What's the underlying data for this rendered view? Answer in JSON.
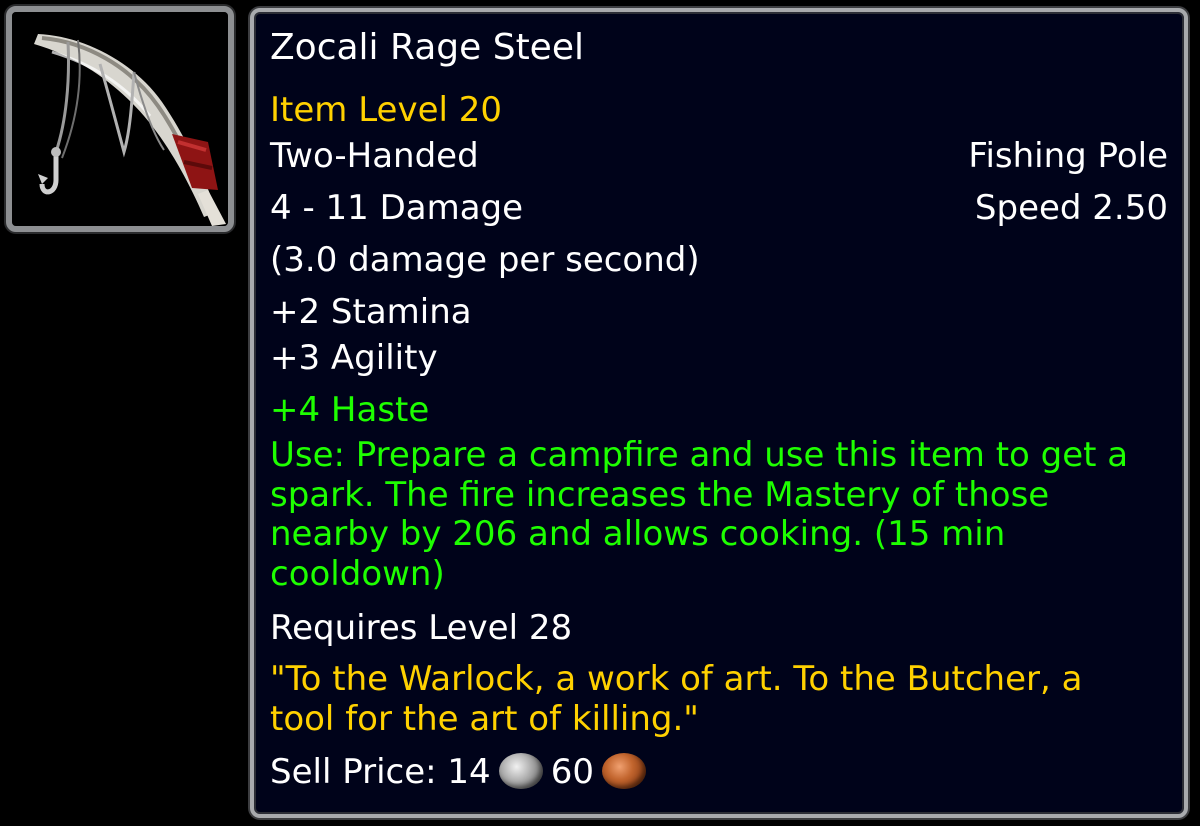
{
  "item": {
    "icon": "fishing-pole-icon",
    "name": "Zocali Rage Steel",
    "item_level": "Item Level 20",
    "slot": "Two-Handed",
    "type": "Fishing Pole",
    "damage": "4 - 11 Damage",
    "speed": "Speed 2.50",
    "dps": "(3.0 damage per second)",
    "stats": [
      "+2 Stamina",
      "+3 Agility"
    ],
    "bonus_stat": "+4 Haste",
    "use_effect": "Use: Prepare a campfire and use this item to get a spark. The fire increases the Mastery of those nearby by 206 and allows cooking. (15 min cooldown)",
    "requirement": "Requires Level 28",
    "flavor_text": "\"To the Warlock, a work of art. To the Butcher, a tool for the art of killing.\"",
    "sell_price": {
      "label": "Sell Price:",
      "silver": "14",
      "copper": "60",
      "silver_icon": "silver-coin-icon",
      "copper_icon": "copper-coin-icon"
    }
  },
  "colors": {
    "background": "#000000",
    "tooltip_bg": "#00031a",
    "border": "#a8aaad",
    "text_white": "#ffffff",
    "text_gold": "#ffd100",
    "text_green": "#1eff00"
  }
}
